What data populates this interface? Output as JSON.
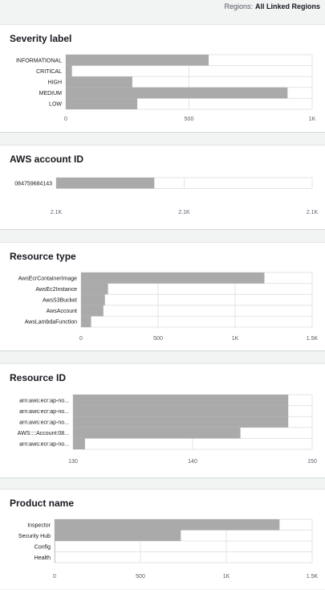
{
  "header": {
    "regions_label": "Regions:",
    "regions_value": "All Linked Regions"
  },
  "panels": [
    {
      "title": "Severity label",
      "chart_data": {
        "type": "bar",
        "orientation": "horizontal",
        "categories": [
          "INFORMATIONAL",
          "CRITICAL",
          "HIGH",
          "MEDIUM",
          "LOW"
        ],
        "values": [
          580,
          25,
          270,
          900,
          290
        ],
        "xlim": [
          0,
          1000
        ],
        "ticks": [
          0,
          500,
          1000
        ],
        "tick_labels": [
          "0",
          "500",
          "1K"
        ],
        "bar_color": "#aaaaaa",
        "grid": true
      }
    },
    {
      "title": "AWS account ID",
      "chart_data": {
        "type": "bar",
        "orientation": "horizontal",
        "categories": [
          "084759684143"
        ],
        "values": [
          2070
        ],
        "xlim": [
          0,
          5400
        ],
        "ticks": [
          0,
          2700,
          5400
        ],
        "tick_labels": [
          "2.1K",
          "2.1K",
          "2.1K"
        ],
        "bar_color": "#aaaaaa",
        "grid": true
      }
    },
    {
      "title": "Resource type",
      "chart_data": {
        "type": "bar",
        "orientation": "horizontal",
        "categories": [
          "AwsEcrContainerImage",
          "AwsEc2Instance",
          "AwsS3Bucket",
          "AwsAccount",
          "AwsLambdaFunction"
        ],
        "values": [
          1190,
          175,
          155,
          145,
          65
        ],
        "xlim": [
          0,
          1500
        ],
        "ticks": [
          0,
          500,
          1000,
          1500
        ],
        "tick_labels": [
          "0",
          "500",
          "1K",
          "1.5K"
        ],
        "bar_color": "#aaaaaa",
        "grid": true
      }
    },
    {
      "title": "Resource ID",
      "chart_data": {
        "type": "bar",
        "orientation": "horizontal",
        "categories": [
          "arn:aws:ecr:ap-no...",
          "arn:aws:ecr:ap-no...",
          "arn:aws:ecr:ap-no...",
          "AWS::::Account:08...",
          "arn:aws:ecr:ap-no..."
        ],
        "values": [
          148,
          148,
          148,
          144,
          131
        ],
        "xlim": [
          130,
          150
        ],
        "ticks": [
          130,
          140,
          150
        ],
        "tick_labels": [
          "130",
          "140",
          "150"
        ],
        "bar_color": "#aaaaaa",
        "grid": true
      }
    },
    {
      "title": "Product name",
      "chart_data": {
        "type": "bar",
        "orientation": "horizontal",
        "categories": [
          "Inspector",
          "Security Hub",
          "Config",
          "Health"
        ],
        "values": [
          1310,
          735,
          3,
          3
        ],
        "xlim": [
          0,
          1500
        ],
        "ticks": [
          0,
          500,
          1000,
          1500
        ],
        "tick_labels": [
          "0",
          "500",
          "1K",
          "1.5K"
        ],
        "bar_color": "#aaaaaa",
        "grid": true
      }
    }
  ]
}
